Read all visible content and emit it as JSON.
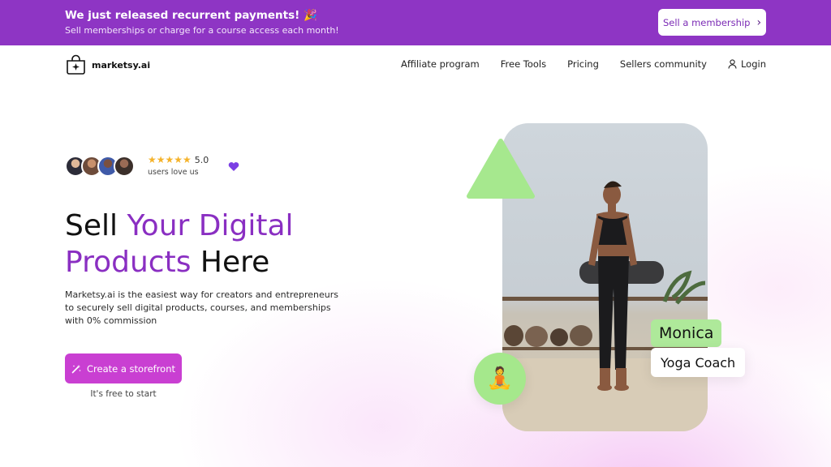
{
  "banner": {
    "title": "We just released recurrent payments! 🎉",
    "subtitle": "Sell memberships or charge for a course access each month!",
    "button_label": "Sell a membership"
  },
  "nav": {
    "brand": "marketsy.ai",
    "links": [
      "Affiliate program",
      "Free Tools",
      "Pricing",
      "Sellers community"
    ],
    "login_label": "Login"
  },
  "hero": {
    "rating_stars": "★★★★★",
    "rating_score": "5.0",
    "rating_label": "users love us",
    "headline": {
      "part1": "Sell ",
      "part2": "Your Digital",
      "part3": "Products",
      "part4": " Here"
    },
    "description": "Marketsy.ai is the easiest way for creators and entrepreneurs to securely sell digital products, courses, and memberships with 0% commission",
    "cta_label": "Create a storefront",
    "cta_note": "It's free to start"
  },
  "showcase": {
    "badge_emoji": "🧘",
    "name": "Monica",
    "role": "Yoga Coach"
  },
  "colors": {
    "banner": "#8e35c4",
    "accent_purple": "#8a2fc2",
    "cta": "#c93fd2",
    "green": "#a5e88c",
    "star": "#f5b32b"
  },
  "icons": [
    "bag-sparkle-logo-icon",
    "chevron-right-icon",
    "user-icon",
    "star-icon",
    "heart-icon",
    "magic-wand-icon",
    "triangle-shape",
    "yoga-icon"
  ]
}
